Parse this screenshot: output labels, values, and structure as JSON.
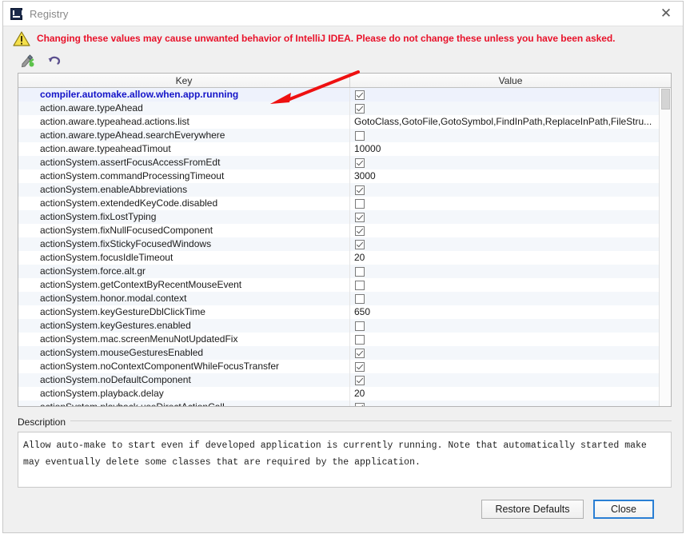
{
  "window": {
    "title": "Registry",
    "app_icon": "intellij-idea-icon",
    "close_icon": "close-icon"
  },
  "warning": {
    "icon": "warning-triangle-icon",
    "text": "Changing these values may cause unwanted behavior of IntelliJ IDEA. Please do not change these unless you have been asked.",
    "color": "#e8122a"
  },
  "toolbar": {
    "buttons": [
      {
        "name": "edit-value-button",
        "icon": "pencil-edit-icon"
      },
      {
        "name": "revert-value-button",
        "icon": "undo-revert-icon"
      }
    ]
  },
  "table": {
    "columns": [
      "Key",
      "Value"
    ],
    "selected_index": 0,
    "rows": [
      {
        "key": "compiler.automake.allow.when.app.running",
        "type": "checkbox",
        "checked": true
      },
      {
        "key": "action.aware.typeAhead",
        "type": "checkbox",
        "checked": true
      },
      {
        "key": "action.aware.typeahead.actions.list",
        "type": "text",
        "value": "GotoClass,GotoFile,GotoSymbol,FindInPath,ReplaceInPath,FileStru..."
      },
      {
        "key": "action.aware.typeAhead.searchEverywhere",
        "type": "checkbox",
        "checked": false
      },
      {
        "key": "action.aware.typeaheadTimout",
        "type": "text",
        "value": "10000"
      },
      {
        "key": "actionSystem.assertFocusAccessFromEdt",
        "type": "checkbox",
        "checked": true
      },
      {
        "key": "actionSystem.commandProcessingTimeout",
        "type": "text",
        "value": "3000"
      },
      {
        "key": "actionSystem.enableAbbreviations",
        "type": "checkbox",
        "checked": true
      },
      {
        "key": "actionSystem.extendedKeyCode.disabled",
        "type": "checkbox",
        "checked": false
      },
      {
        "key": "actionSystem.fixLostTyping",
        "type": "checkbox",
        "checked": true
      },
      {
        "key": "actionSystem.fixNullFocusedComponent",
        "type": "checkbox",
        "checked": true
      },
      {
        "key": "actionSystem.fixStickyFocusedWindows",
        "type": "checkbox",
        "checked": true
      },
      {
        "key": "actionSystem.focusIdleTimeout",
        "type": "text",
        "value": "20"
      },
      {
        "key": "actionSystem.force.alt.gr",
        "type": "checkbox",
        "checked": false
      },
      {
        "key": "actionSystem.getContextByRecentMouseEvent",
        "type": "checkbox",
        "checked": false
      },
      {
        "key": "actionSystem.honor.modal.context",
        "type": "checkbox",
        "checked": false
      },
      {
        "key": "actionSystem.keyGestureDblClickTime",
        "type": "text",
        "value": "650"
      },
      {
        "key": "actionSystem.keyGestures.enabled",
        "type": "checkbox",
        "checked": false
      },
      {
        "key": "actionSystem.mac.screenMenuNotUpdatedFix",
        "type": "checkbox",
        "checked": false
      },
      {
        "key": "actionSystem.mouseGesturesEnabled",
        "type": "checkbox",
        "checked": true
      },
      {
        "key": "actionSystem.noContextComponentWhileFocusTransfer",
        "type": "checkbox",
        "checked": true
      },
      {
        "key": "actionSystem.noDefaultComponent",
        "type": "checkbox",
        "checked": true
      },
      {
        "key": "actionSystem.playback.delay",
        "type": "text",
        "value": "20"
      },
      {
        "key": "actionSystem.playback.useDirectActionCall",
        "type": "checkbox",
        "checked": true
      }
    ]
  },
  "description": {
    "label": "Description",
    "text": "Allow auto-make to start even if developed application is currently running. Note that automatically started make may eventually delete some classes that are required by the application."
  },
  "buttons": {
    "restore_defaults": "Restore Defaults",
    "close": "Close"
  },
  "annotation": {
    "arrow_color": "#ee1111"
  }
}
